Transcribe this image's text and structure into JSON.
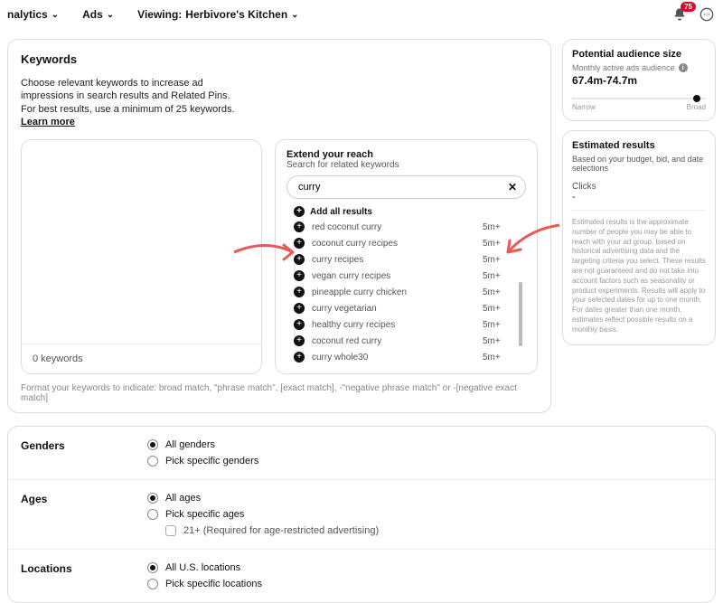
{
  "nav": {
    "analytics": "nalytics",
    "ads": "Ads",
    "viewing_prefix": "Viewing:",
    "viewing_value": "Herbivore's Kitchen",
    "notif_count": "75"
  },
  "keywords": {
    "heading": "Keywords",
    "intro": "Choose relevant keywords to increase ad impressions in search results and Related Pins. For best results, use a minimum of 25 keywords.",
    "learn_more": "Learn more",
    "count": "0 keywords",
    "hint": "Format your keywords to indicate: broad match, \"phrase match\", [exact match], -\"negative phrase match\" or -[negative exact match]"
  },
  "extend": {
    "title": "Extend your reach",
    "subtitle": "Search for related keywords",
    "search_value": "curry",
    "add_all": "Add all results",
    "results": [
      {
        "kw": "red coconut curry",
        "vol": "5m+"
      },
      {
        "kw": "coconut curry recipes",
        "vol": "5m+"
      },
      {
        "kw": "curry recipes",
        "vol": "5m+"
      },
      {
        "kw": "vegan curry recipes",
        "vol": "5m+"
      },
      {
        "kw": "pineapple curry chicken",
        "vol": "5m+"
      },
      {
        "kw": "curry vegetarian",
        "vol": "5m+"
      },
      {
        "kw": "healthy curry recipes",
        "vol": "5m+"
      },
      {
        "kw": "coconut red curry",
        "vol": "5m+"
      },
      {
        "kw": "curry whole30",
        "vol": "5m+"
      }
    ]
  },
  "audience": {
    "heading": "Potential audience size",
    "sub": "Monthly active ads audience",
    "value": "67.4m-74.7m",
    "narrow": "Narrow",
    "broad": "Broad"
  },
  "estimated": {
    "heading": "Estimated results",
    "sub": "Based on your budget, bid, and date selections",
    "metric": "Clicks",
    "metric_val": "-",
    "foot": "Estimated results is the approximate number of people you may be able to reach with your ad group, based on historical advertising data and the targeting criteria you select. These results are not guaranteed and do not take into account factors such as seasonality or product experiments. Results will apply to your selected dates for up to one month. For dates greater than one month, estimates reflect possible results on a monthly basis."
  },
  "genders": {
    "label": "Genders",
    "opt1": "All genders",
    "opt2": "Pick specific genders"
  },
  "ages": {
    "label": "Ages",
    "opt1": "All ages",
    "opt2": "Pick specific ages",
    "check": "21+ (Required for age-restricted advertising)"
  },
  "locations": {
    "label": "Locations",
    "opt1": "All U.S. locations",
    "opt2": "Pick specific locations"
  }
}
